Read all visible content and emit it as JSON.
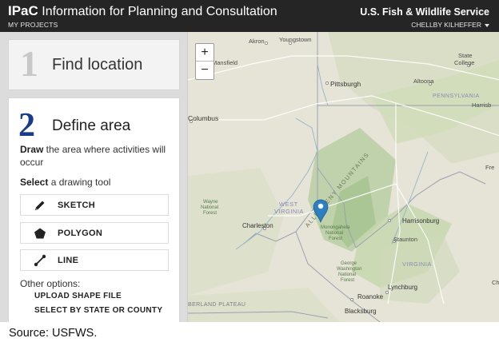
{
  "header": {
    "brand_short": "IPaC",
    "brand_long": "Information for Planning and Consultation",
    "my_projects": "MY PROJECTS",
    "agency": "U.S. Fish & Wildlife Service",
    "user": "CHELLBY KILHEFFER"
  },
  "steps": [
    {
      "number": "1",
      "title": "Find location"
    },
    {
      "number": "2",
      "title": "Define area"
    }
  ],
  "define": {
    "desc_bold": "Draw",
    "desc_rest": " the area where activities will occur",
    "select_bold": "Select",
    "select_rest": " a drawing tool",
    "tools": [
      {
        "label": "SKETCH",
        "icon": "pencil-icon"
      },
      {
        "label": "POLYGON",
        "icon": "pentagon-icon"
      },
      {
        "label": "LINE",
        "icon": "line-icon"
      }
    ],
    "other_label": "Other options:",
    "options": [
      "UPLOAD SHAPE FILE",
      "SELECT BY STATE OR COUNTY"
    ]
  },
  "map": {
    "zoom_in": "+",
    "zoom_out": "−",
    "labels": {
      "akron": "Akron",
      "youngstown": "Youngstown",
      "mansfield": "Mansfield",
      "state_college_1": "State",
      "state_college_2": "College",
      "pittsburgh": "Pittsburgh",
      "altoona": "Altoona",
      "pennsylvania": "PENNSYLVANIA",
      "harrisburg": "Harrisb",
      "columbus": "Columbus",
      "mountains": "ALLEGHENY MOUNTAINS",
      "west": "WEST",
      "virginia_state": "VIRGINIA",
      "wayne_1": "Wayne",
      "wayne_2": "National",
      "wayne_3": "Forest",
      "charleston": "Charleston",
      "mon_1": "Monongahela",
      "mon_2": "National",
      "mon_3": "Forest",
      "harrisonburg": "Harrisonburg",
      "staunton": "Staunton",
      "virginia": "VIRGINIA",
      "gw_1": "George",
      "gw_2": "Washington",
      "gw_3": "National",
      "gw_4": "Forest",
      "lynchburg": "Lynchburg",
      "roanoke": "Roanoke",
      "blacksburg": "Blacksburg",
      "plateau": "BERLAND PLATEAU",
      "edge_1": "Fre",
      "edge_2": "Ch"
    }
  },
  "source": "Source: USFWS.",
  "colors": {
    "header_bg": "#252525",
    "step_number_active": "#1a3b8a",
    "step_number_done": "#c8c8c8",
    "marker": "#2d7fc1"
  }
}
